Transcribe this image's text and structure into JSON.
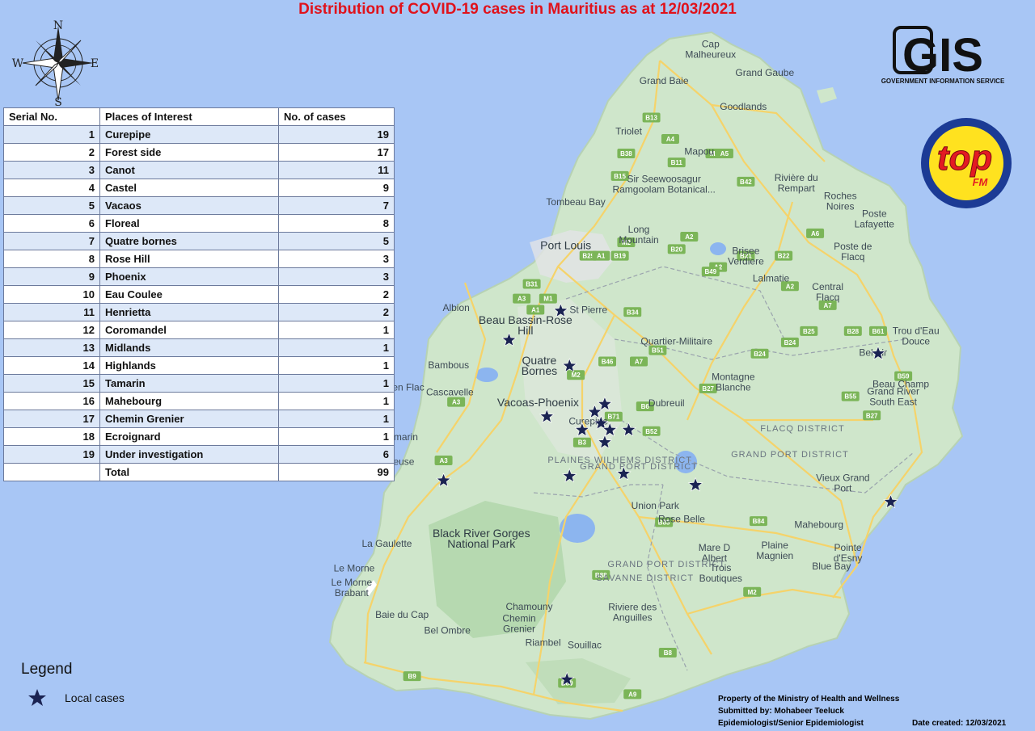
{
  "title": "Distribution of COVID-19 cases in Mauritius as at 12/03/2021",
  "compass": {
    "north": "N",
    "south": "S",
    "east": "E",
    "west": "W"
  },
  "table": {
    "headers": [
      "Serial No.",
      "Places of Interest",
      "No. of cases"
    ],
    "rows": [
      {
        "serial": "1",
        "place": "Curepipe",
        "cases": "19"
      },
      {
        "serial": "2",
        "place": "Forest side",
        "cases": "17"
      },
      {
        "serial": "3",
        "place": "Canot",
        "cases": "11"
      },
      {
        "serial": "4",
        "place": "Castel",
        "cases": "9"
      },
      {
        "serial": "5",
        "place": "Vacaos",
        "cases": "7"
      },
      {
        "serial": "6",
        "place": "Floreal",
        "cases": "8"
      },
      {
        "serial": "7",
        "place": "Quatre bornes",
        "cases": "5"
      },
      {
        "serial": "8",
        "place": "Rose Hill",
        "cases": "3"
      },
      {
        "serial": "9",
        "place": "Phoenix",
        "cases": "3"
      },
      {
        "serial": "10",
        "place": "Eau Coulee",
        "cases": "2"
      },
      {
        "serial": "11",
        "place": "Henrietta",
        "cases": "2"
      },
      {
        "serial": "12",
        "place": "Coromandel",
        "cases": "1"
      },
      {
        "serial": "13",
        "place": "Midlands",
        "cases": "1"
      },
      {
        "serial": "14",
        "place": "Highlands",
        "cases": "1"
      },
      {
        "serial": "15",
        "place": "Tamarin",
        "cases": "1"
      },
      {
        "serial": "16",
        "place": "Mahebourg",
        "cases": "1"
      },
      {
        "serial": "17",
        "place": "Chemin Grenier",
        "cases": "1"
      },
      {
        "serial": "18",
        "place": "Ecroignard",
        "cases": "1"
      },
      {
        "serial": "19",
        "place": "Under investigation",
        "cases": "6"
      }
    ],
    "total_label": "Total",
    "total_value": "99"
  },
  "legend": {
    "title": "Legend",
    "item_label": "Local cases",
    "marker_icon": "star-icon",
    "marker_color": "#1a2352"
  },
  "logos": {
    "gis_text": "GIS",
    "gis_subtitle": "GOVERNMENT INFORMATION SERVICE",
    "topfm_text": "top",
    "topfm_sub": "FM"
  },
  "footer": {
    "line1": "Property of the Ministry of Health and Wellness",
    "line2": "Submitted by: Mohabeer Teeluck",
    "line3": "Epidemiologist/Senior Epidemiologist",
    "date_created": "Date created: 12/03/2021"
  },
  "colors": {
    "ocean": "#a8c6f5",
    "land": "#cfe6cb",
    "title": "#e0121b",
    "star": "#1a2352",
    "road": "#f5d36a",
    "water": "#8cb5ef"
  },
  "map": {
    "places": [
      {
        "name": "Cap Malheureux",
        "x": 57.617,
        "y": -19.984
      },
      {
        "name": "Grand Baie",
        "x": 57.58,
        "y": -20.013
      },
      {
        "name": "Grand Gaube",
        "x": 57.66,
        "y": -20.006
      },
      {
        "name": "Goodlands",
        "x": 57.643,
        "y": -20.036
      },
      {
        "name": "Triolet",
        "x": 57.552,
        "y": -20.058
      },
      {
        "name": "Mapou",
        "x": 57.608,
        "y": -20.076
      },
      {
        "name": "Sir Seewoosagur Ramgoolam Botanical...",
        "x": 57.58,
        "y": -20.104
      },
      {
        "name": "Rivière du Rempart",
        "x": 57.685,
        "y": -20.103
      },
      {
        "name": "Roches Noires",
        "x": 57.72,
        "y": -20.119
      },
      {
        "name": "Tombeau Bay",
        "x": 57.51,
        "y": -20.121
      },
      {
        "name": "Long Mountain",
        "x": 57.56,
        "y": -20.149
      },
      {
        "name": "Poste Lafayette",
        "x": 57.747,
        "y": -20.135
      },
      {
        "name": "Port Louis",
        "x": 57.502,
        "y": -20.16
      },
      {
        "name": "Brisee Verdiere",
        "x": 57.645,
        "y": -20.168
      },
      {
        "name": "Poste de Flacq",
        "x": 57.73,
        "y": -20.164
      },
      {
        "name": "Lalmatie",
        "x": 57.665,
        "y": -20.189
      },
      {
        "name": "Central Flacq",
        "x": 57.71,
        "y": -20.2
      },
      {
        "name": "Albion",
        "x": 57.415,
        "y": -20.215
      },
      {
        "name": "St Pierre",
        "x": 57.52,
        "y": -20.217
      },
      {
        "name": "Beau Bassin-Rose Hill",
        "x": 57.47,
        "y": -20.23
      },
      {
        "name": "Trou d'Eau Douce",
        "x": 57.78,
        "y": -20.239
      },
      {
        "name": "Quartier-Militaire",
        "x": 57.59,
        "y": -20.245
      },
      {
        "name": "Bel Air",
        "x": 57.746,
        "y": -20.255
      },
      {
        "name": "Bambous",
        "x": 57.409,
        "y": -20.266
      },
      {
        "name": "Quatre Bornes",
        "x": 57.481,
        "y": -20.266
      },
      {
        "name": "Flic en Flac",
        "x": 57.37,
        "y": -20.286
      },
      {
        "name": "Cascavelle",
        "x": 57.41,
        "y": -20.29
      },
      {
        "name": "Montagne Blanche",
        "x": 57.635,
        "y": -20.28
      },
      {
        "name": "Beau Champ",
        "x": 57.768,
        "y": -20.283
      },
      {
        "name": "Grand River South East",
        "x": 57.762,
        "y": -20.293
      },
      {
        "name": "Vacoas-Phoenix",
        "x": 57.48,
        "y": -20.3
      },
      {
        "name": "Dubreuil",
        "x": 57.582,
        "y": -20.3
      },
      {
        "name": "Curepipe",
        "x": 57.52,
        "y": -20.316
      },
      {
        "name": "Tamarin",
        "x": 57.371,
        "y": -20.33
      },
      {
        "name": "La Preneuse",
        "x": 57.36,
        "y": -20.352
      },
      {
        "name": "Vieux Grand Port",
        "x": 57.722,
        "y": -20.37
      },
      {
        "name": "Union Park",
        "x": 57.573,
        "y": -20.391
      },
      {
        "name": "Rose Belle",
        "x": 57.594,
        "y": -20.403
      },
      {
        "name": "Mahebourg",
        "x": 57.703,
        "y": -20.408
      },
      {
        "name": "Black River Gorges National Park",
        "x": 57.435,
        "y": -20.42
      },
      {
        "name": "La Gaulette",
        "x": 57.36,
        "y": -20.425
      },
      {
        "name": "Mare D Albert",
        "x": 57.62,
        "y": -20.432
      },
      {
        "name": "Plaine Magnien",
        "x": 57.668,
        "y": -20.43
      },
      {
        "name": "Pointe d'Esny",
        "x": 57.726,
        "y": -20.432
      },
      {
        "name": "Le Morne",
        "x": 57.334,
        "y": -20.447
      },
      {
        "name": "Blue Bay",
        "x": 57.713,
        "y": -20.445
      },
      {
        "name": "Trois Boutiques",
        "x": 57.625,
        "y": -20.45
      },
      {
        "name": "Le Morne Brabant",
        "x": 57.332,
        "y": -20.463
      },
      {
        "name": "Baie du Cap",
        "x": 57.372,
        "y": -20.488
      },
      {
        "name": "Chamouny",
        "x": 57.473,
        "y": -20.481
      },
      {
        "name": "Riviere des Anguilles",
        "x": 57.555,
        "y": -20.485
      },
      {
        "name": "Chemin Grenier",
        "x": 57.465,
        "y": -20.495
      },
      {
        "name": "Bel Ombre",
        "x": 57.408,
        "y": -20.502
      },
      {
        "name": "Riambel",
        "x": 57.484,
        "y": -20.513
      },
      {
        "name": "Souillac",
        "x": 57.517,
        "y": -20.515
      }
    ],
    "districts": [
      {
        "name": "FLACQ DISTRICT",
        "x": 57.69,
        "y": -20.322
      },
      {
        "name": "GRAND PORT DISTRICT",
        "x": 57.68,
        "y": -20.345
      },
      {
        "name": "PLAINES WILHEMS DISTRICT",
        "x": 57.545,
        "y": -20.35
      },
      {
        "name": "GRAND PORT DISTRICT",
        "x": 57.56,
        "y": -20.356
      },
      {
        "name": "GRAND PORT DISTRICT",
        "x": 57.582,
        "y": -20.443
      },
      {
        "name": "SAVANNE DISTRICT",
        "x": 57.565,
        "y": -20.455
      }
    ],
    "roads": [
      {
        "label": "B13",
        "x": 57.57,
        "y": -20.043
      },
      {
        "label": "A4",
        "x": 57.585,
        "y": -20.062
      },
      {
        "label": "B38",
        "x": 57.55,
        "y": -20.075
      },
      {
        "label": "M2",
        "x": 57.62,
        "y": -20.075
      },
      {
        "label": "A5",
        "x": 57.628,
        "y": -20.075
      },
      {
        "label": "B11",
        "x": 57.59,
        "y": -20.083
      },
      {
        "label": "B15",
        "x": 57.545,
        "y": -20.095
      },
      {
        "label": "B42",
        "x": 57.645,
        "y": -20.1
      },
      {
        "label": "M2",
        "x": 57.55,
        "y": -20.154
      },
      {
        "label": "A2",
        "x": 57.6,
        "y": -20.149
      },
      {
        "label": "A6",
        "x": 57.7,
        "y": -20.146
      },
      {
        "label": "B29",
        "x": 57.52,
        "y": -20.166
      },
      {
        "label": "A1",
        "x": 57.53,
        "y": -20.166
      },
      {
        "label": "B19",
        "x": 57.545,
        "y": -20.166
      },
      {
        "label": "B20",
        "x": 57.59,
        "y": -20.16
      },
      {
        "label": "B21",
        "x": 57.645,
        "y": -20.166
      },
      {
        "label": "B22",
        "x": 57.675,
        "y": -20.166
      },
      {
        "label": "A2",
        "x": 57.623,
        "y": -20.176
      },
      {
        "label": "B49",
        "x": 57.617,
        "y": -20.18
      },
      {
        "label": "A2",
        "x": 57.68,
        "y": -20.193
      },
      {
        "label": "A7",
        "x": 57.71,
        "y": -20.21
      },
      {
        "label": "B31",
        "x": 57.475,
        "y": -20.191
      },
      {
        "label": "A3",
        "x": 57.467,
        "y": -20.204
      },
      {
        "label": "M1",
        "x": 57.488,
        "y": -20.204
      },
      {
        "label": "A1",
        "x": 57.478,
        "y": -20.214
      },
      {
        "label": "B34",
        "x": 57.555,
        "y": -20.216
      },
      {
        "label": "B25",
        "x": 57.695,
        "y": -20.233
      },
      {
        "label": "B28",
        "x": 57.73,
        "y": -20.233
      },
      {
        "label": "B61",
        "x": 57.75,
        "y": -20.233
      },
      {
        "label": "B24",
        "x": 57.68,
        "y": -20.243
      },
      {
        "label": "B51",
        "x": 57.575,
        "y": -20.25
      },
      {
        "label": "B24",
        "x": 57.656,
        "y": -20.253
      },
      {
        "label": "A7",
        "x": 57.56,
        "y": -20.26
      },
      {
        "label": "B46",
        "x": 57.535,
        "y": -20.26
      },
      {
        "label": "M2",
        "x": 57.51,
        "y": -20.272
      },
      {
        "label": "B59",
        "x": 57.77,
        "y": -20.273
      },
      {
        "label": "B27",
        "x": 57.615,
        "y": -20.284
      },
      {
        "label": "B55",
        "x": 57.728,
        "y": -20.291
      },
      {
        "label": "A3",
        "x": 57.415,
        "y": -20.296
      },
      {
        "label": "B6",
        "x": 57.565,
        "y": -20.3
      },
      {
        "label": "B71",
        "x": 57.54,
        "y": -20.309
      },
      {
        "label": "B27",
        "x": 57.745,
        "y": -20.308
      },
      {
        "label": "B52",
        "x": 57.57,
        "y": -20.322
      },
      {
        "label": "B3",
        "x": 57.515,
        "y": -20.332
      },
      {
        "label": "A3",
        "x": 57.405,
        "y": -20.348
      },
      {
        "label": "B83",
        "x": 57.58,
        "y": -20.403
      },
      {
        "label": "B84",
        "x": 57.655,
        "y": -20.402
      },
      {
        "label": "B88",
        "x": 57.53,
        "y": -20.45
      },
      {
        "label": "M2",
        "x": 57.65,
        "y": -20.465
      },
      {
        "label": "B8",
        "x": 57.583,
        "y": -20.519
      },
      {
        "label": "B89",
        "x": 57.503,
        "y": -20.546
      },
      {
        "label": "B9",
        "x": 57.38,
        "y": -20.54
      },
      {
        "label": "A9",
        "x": 57.555,
        "y": -20.556
      }
    ],
    "cases": [
      {
        "x": 57.498,
        "y": -20.215
      },
      {
        "x": 57.457,
        "y": -20.241
      },
      {
        "x": 57.505,
        "y": -20.264
      },
      {
        "x": 57.75,
        "y": -20.253
      },
      {
        "x": 57.533,
        "y": -20.298
      },
      {
        "x": 57.525,
        "y": -20.305
      },
      {
        "x": 57.53,
        "y": -20.315
      },
      {
        "x": 57.515,
        "y": -20.321
      },
      {
        "x": 57.537,
        "y": -20.321
      },
      {
        "x": 57.552,
        "y": -20.321
      },
      {
        "x": 57.533,
        "y": -20.332
      },
      {
        "x": 57.487,
        "y": -20.309
      },
      {
        "x": 57.405,
        "y": -20.366
      },
      {
        "x": 57.505,
        "y": -20.362
      },
      {
        "x": 57.548,
        "y": -20.36
      },
      {
        "x": 57.605,
        "y": -20.37
      },
      {
        "x": 57.76,
        "y": -20.385
      },
      {
        "x": 57.503,
        "y": -20.543
      }
    ]
  }
}
